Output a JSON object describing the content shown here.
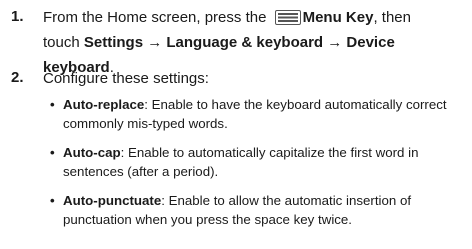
{
  "steps": [
    {
      "number": "1.",
      "line1_before": "From the Home screen, press the",
      "menu_key_icon": "menu-key-icon",
      "menu_key_label": "Menu Key",
      "line1_after": ", then",
      "line2_before": "touch ",
      "path": "Settings → Language & keyboard → Device keyboard",
      "line2_after": "."
    },
    {
      "number": "2.",
      "text": "Configure these settings:"
    }
  ],
  "bullets": [
    {
      "term": "Auto-replace",
      "description": ": Enable to have the keyboard automatically correct commonly mis-typed words."
    },
    {
      "term": "Auto-cap",
      "description": ": Enable to automatically capitalize the first word in sentences (after a period)."
    },
    {
      "term": "Auto-punctuate",
      "description": ": Enable to allow the automatic insertion of punctuation when you press the space key twice."
    }
  ],
  "bullet_glyph": "•"
}
